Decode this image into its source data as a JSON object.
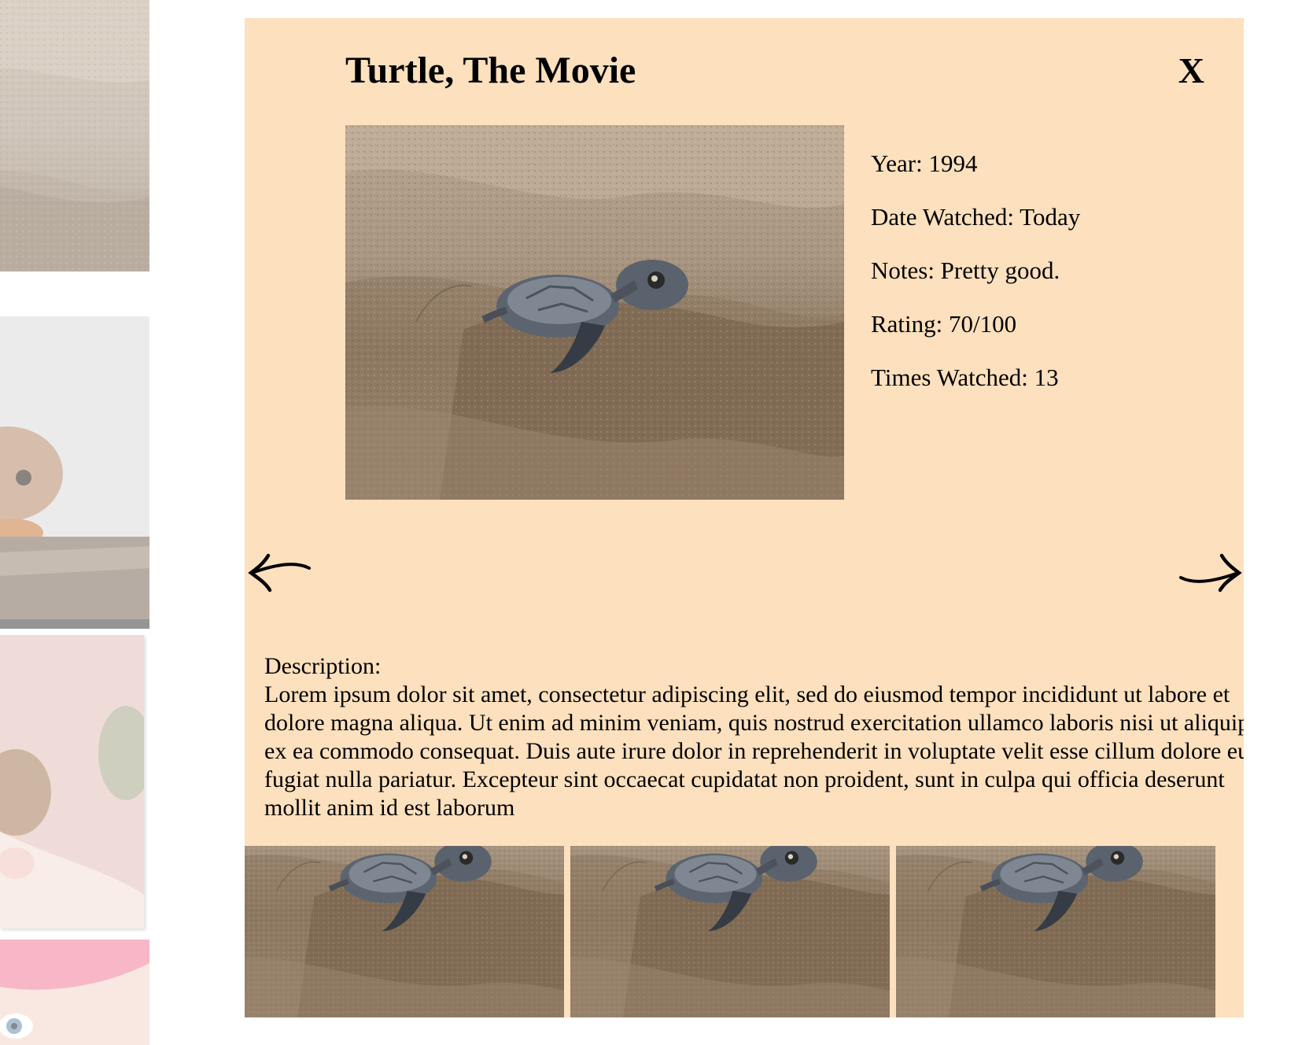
{
  "movie": {
    "title": "Turtle, The Movie",
    "close_label": "X",
    "poster_icon": "baby-turtle-on-sand-photo"
  },
  "details": [
    {
      "label": "Year: 1994"
    },
    {
      "label": "Date Watched: Today"
    },
    {
      "label": "Notes: Pretty good."
    },
    {
      "label": "Rating: 70/100"
    },
    {
      "label": "Times Watched: 13"
    }
  ],
  "navigation": {
    "prev_icon": "arrow-left-icon",
    "next_icon": "arrow-right-icon"
  },
  "description": {
    "heading": "Description:",
    "text": "Lorem ipsum dolor sit amet, consectetur adipiscing elit, sed do eiusmod tempor incididunt ut labore et dolore magna aliqua. Ut enim ad minim veniam, quis nostrud exercitation ullamco laboris nisi ut aliquip ex ea commodo consequat. Duis aute irure dolor in reprehenderit in voluptate velit esse cillum dolore eu fugiat nulla pariatur. Excepteur sint occaecat cupidatat non proident, sunt in culpa qui officia deserunt mollit anim id est laborum"
  },
  "thumbnails": [
    {
      "icon": "baby-turtle-thumbnail"
    },
    {
      "icon": "baby-turtle-thumbnail"
    },
    {
      "icon": "baby-turtle-thumbnail"
    }
  ],
  "background_gallery": [
    {
      "icon": "turtle-photo"
    },
    {
      "icon": "squirrel-photo"
    },
    {
      "icon": "hand-holding-animal-photo"
    },
    {
      "icon": "child-in-pink-hat-photo"
    }
  ],
  "colors": {
    "modal_background": "#fde0bd",
    "text": "#000000",
    "page_background": "#ffffff"
  }
}
